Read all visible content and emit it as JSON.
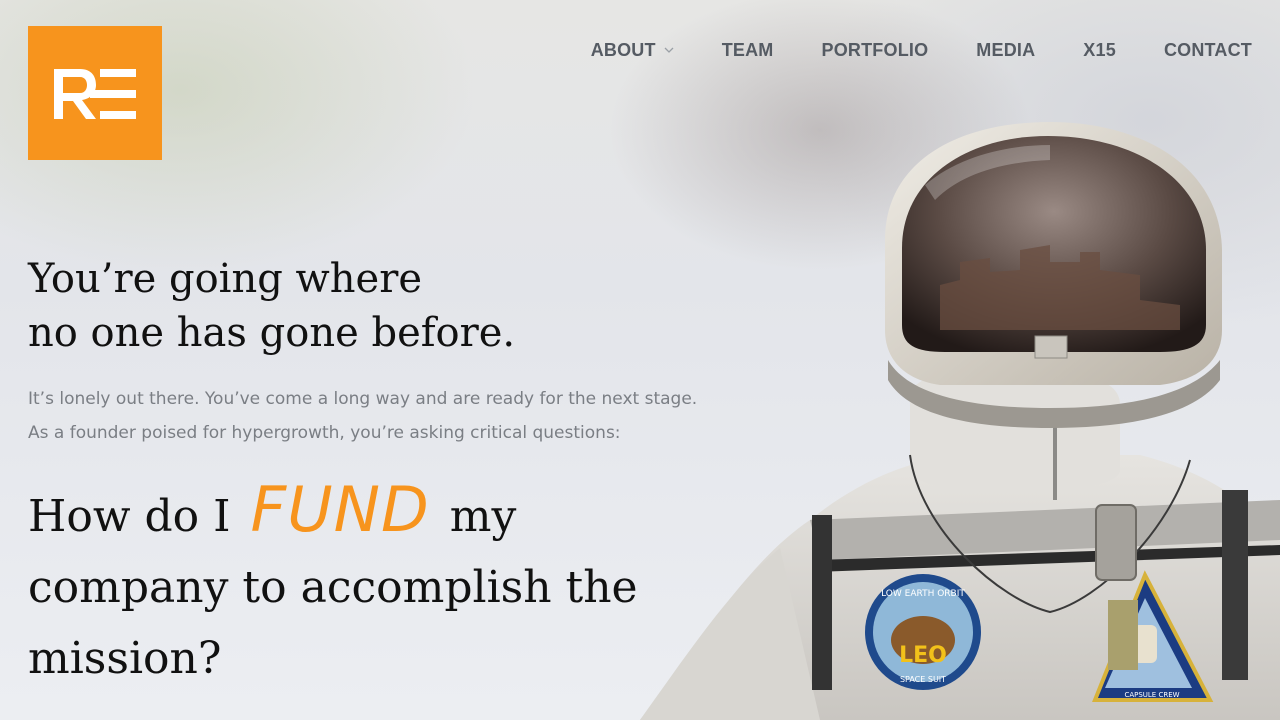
{
  "brand": {
    "logo_text": "RE",
    "accent_color": "#f7941d"
  },
  "nav": {
    "items": [
      {
        "label": "ABOUT",
        "has_dropdown": true
      },
      {
        "label": "TEAM"
      },
      {
        "label": "PORTFOLIO"
      },
      {
        "label": "MEDIA"
      },
      {
        "label": "X15"
      },
      {
        "label": "CONTACT"
      }
    ]
  },
  "hero": {
    "headline_line1": "You’re going where",
    "headline_line2": "no one has gone before.",
    "intro_line1": "It’s lonely out there. You’ve come a long way and are ready for the next stage.",
    "intro_line2": "As a founder poised for hypergrowth, you’re asking critical questions:",
    "question_prefix": "How do I",
    "question_accent": "FUND",
    "question_suffix": "my company to accomplish the mission?"
  },
  "patches": {
    "leo_top": "LOW EARTH ORBIT",
    "leo_center": "LEO",
    "leo_bottom": "SPACE SUIT",
    "crew_label": "CAPSULE CREW"
  },
  "icons": {
    "dropdown": "chevron-down-icon"
  }
}
